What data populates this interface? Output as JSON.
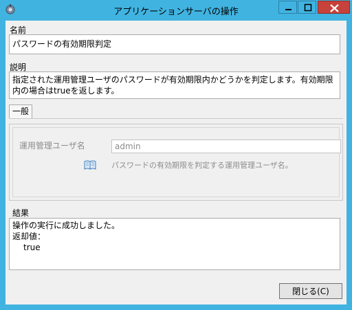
{
  "window": {
    "title": "アプリケーションサーバの操作",
    "accent_color": "#41b3e0",
    "close_color": "#c7423a"
  },
  "name_section": {
    "label": "名前",
    "value": "パスワードの有効期限判定"
  },
  "description_section": {
    "label": "説明",
    "value": "指定された運用管理ユーザのパスワードが有効期限内かどうかを判定します。有効期限内の場合はtrueを返します。"
  },
  "tabs": [
    {
      "label": "一般"
    }
  ],
  "general_tab": {
    "field_label": "運用管理ユーザ名",
    "field_value": "admin",
    "help_text": "パスワードの有効期限を判定する運用管理ユーザ名。",
    "help_icon": "book-icon"
  },
  "result_section": {
    "label": "結果",
    "line1": "操作の実行に成功しました。",
    "line2": "返却値：",
    "line3": "true"
  },
  "buttons": {
    "close_label": "閉じる(C)"
  }
}
